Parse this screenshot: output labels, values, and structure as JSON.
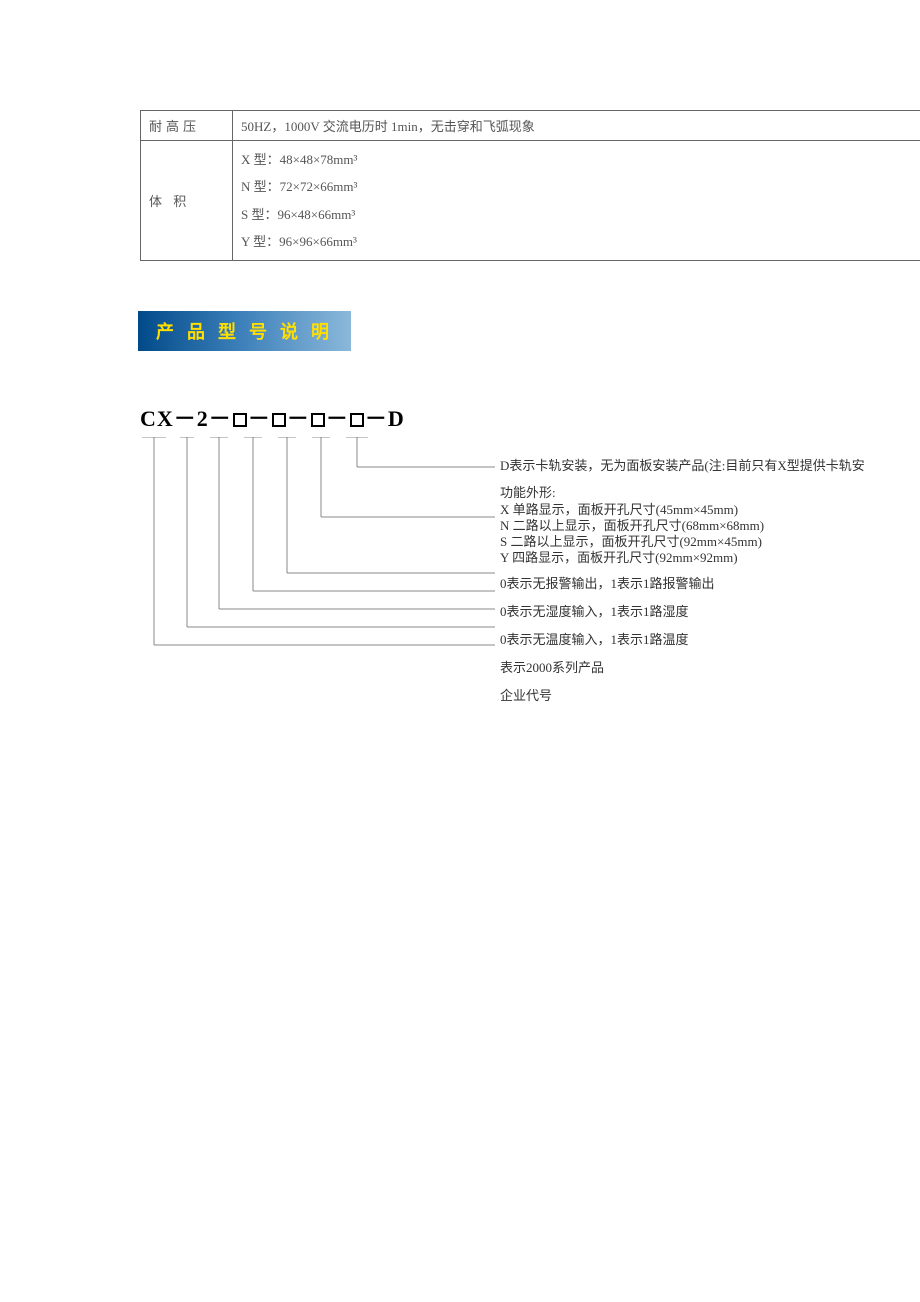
{
  "table": {
    "row1_label": "耐高压",
    "row1_value": "50HZ，1000V 交流电历时 1min，无击穿和飞弧现象",
    "row2_label": "体 积",
    "vol_x": "X 型：48×48×78mm³",
    "vol_n": "N 型：72×72×66mm³",
    "vol_s": "S 型：96×48×66mm³",
    "vol_y": "Y 型：96×96×66mm³"
  },
  "section_title": "产 品 型 号 说 明",
  "model": {
    "prefix": "CX",
    "dash": "－",
    "two": "2",
    "suffix": "D"
  },
  "desc": {
    "d": "D表示卡轨安装，无为面板安装产品(注:目前只有X型提供卡轨安",
    "fn_title": "功能外形:",
    "fn_x": "X 单路显示，面板开孔尺寸(45mm×45mm)",
    "fn_n": "N 二路以上显示，面板开孔尺寸(68mm×68mm)",
    "fn_s": "S 二路以上显示，面板开孔尺寸(92mm×45mm)",
    "fn_y": "Y 四路显示，面板开孔尺寸(92mm×92mm)",
    "alarm": "0表示无报警输出，1表示1路报警输出",
    "humid": "0表示无湿度输入，1表示1路湿度",
    "temp": "0表示无温度输入，1表示1路温度",
    "series": "表示2000系列产品",
    "company": "企业代号"
  }
}
